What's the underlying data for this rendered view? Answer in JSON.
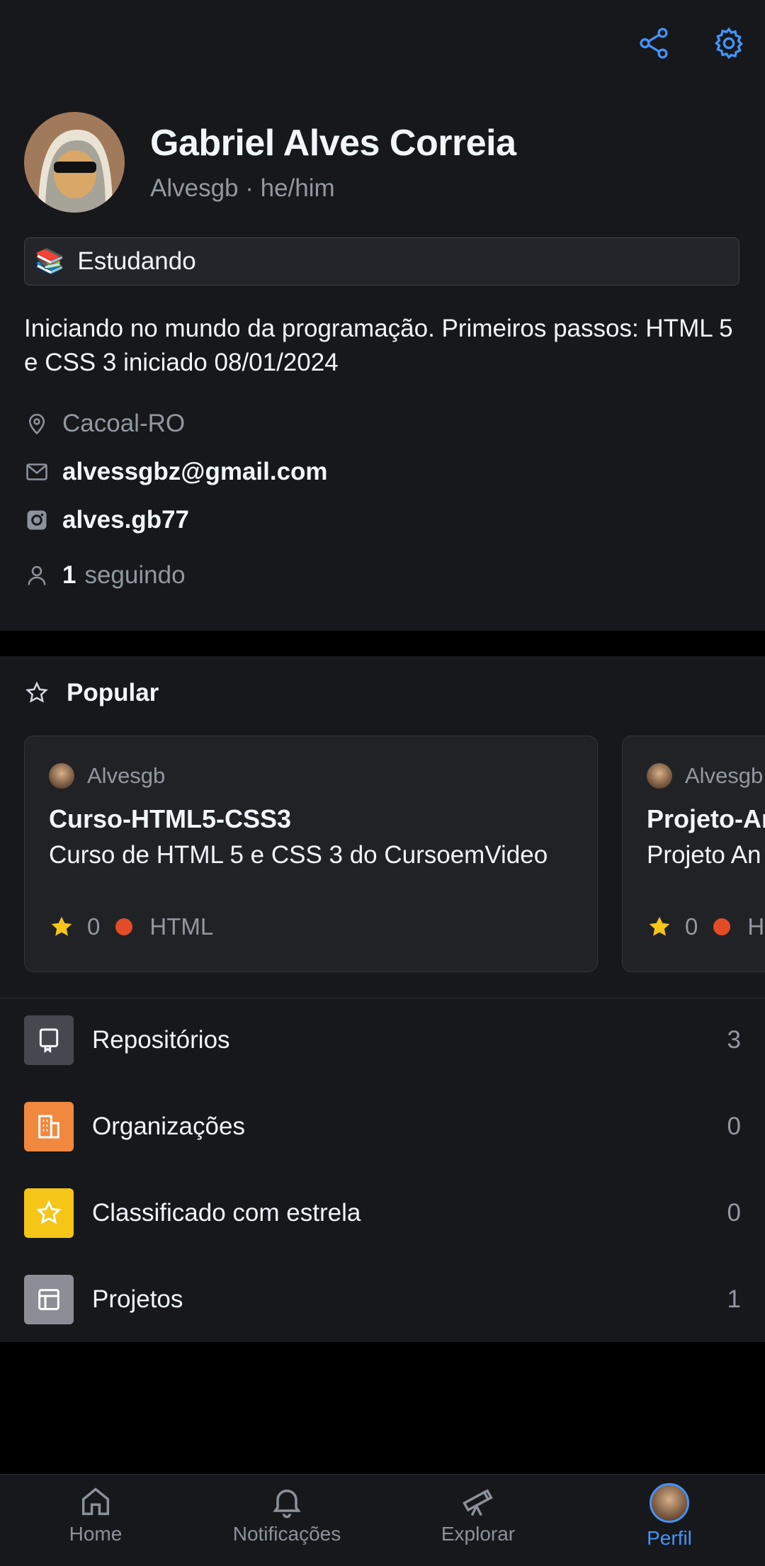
{
  "profile": {
    "name": "Gabriel Alves Correia",
    "handle": "Alvesgb · he/him",
    "status_emoji": "📚",
    "status_text": "Estudando",
    "bio": "Iniciando no mundo da programação. Primeiros passos: HTML 5 e CSS 3 iniciado 08/01/2024",
    "location": "Cacoal-RO",
    "email": "alvessgbz@gmail.com",
    "instagram": "alves.gb77",
    "following_count": "1",
    "following_label": "seguindo"
  },
  "popular": {
    "heading": "Popular",
    "cards": [
      {
        "owner": "Alvesgb",
        "title": "Curso-HTML5-CSS3",
        "description": "Curso de HTML 5 e CSS 3 do CursoemVideo",
        "stars": "0",
        "language": "HTML",
        "language_color": "#e34c26"
      },
      {
        "owner": "Alvesgb",
        "title": "Projeto-Ar",
        "description": "Projeto An",
        "stars": "0",
        "language": "H",
        "language_color": "#e34c26"
      }
    ]
  },
  "menu": [
    {
      "label": "Repositórios",
      "count": "3",
      "icon": "repo-icon",
      "color": "#464850"
    },
    {
      "label": "Organizações",
      "count": "0",
      "icon": "organization-icon",
      "color": "#f0883e"
    },
    {
      "label": "Classificado com estrela",
      "count": "0",
      "icon": "star-icon",
      "color": "#f5c518"
    },
    {
      "label": "Projetos",
      "count": "1",
      "icon": "project-icon",
      "color": "#8b8e96"
    }
  ],
  "nav": {
    "home": "Home",
    "notifications": "Notificações",
    "explore": "Explorar",
    "profile": "Perfil"
  },
  "colors": {
    "accent": "#4493f8",
    "background": "#17181c"
  }
}
